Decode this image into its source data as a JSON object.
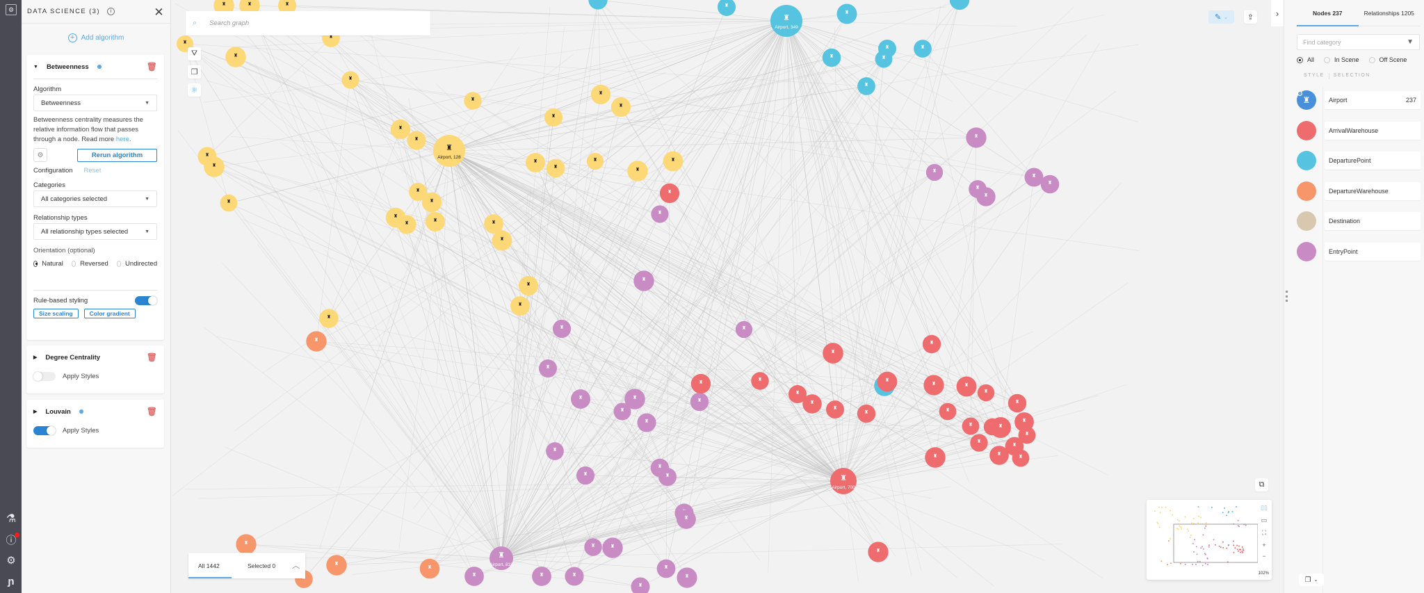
{
  "rail": {
    "top_icon": "panel-settings-icon",
    "bottom_icons": [
      "flask-icon",
      "help-icon",
      "gear-icon",
      "logo-icon"
    ],
    "help_has_notification": true
  },
  "data_science": {
    "title": "DATA SCIENCE (3)",
    "add_algorithm": "Add algorithm",
    "algorithms": [
      {
        "name": "Betweenness",
        "active_dot": true,
        "expanded": true,
        "algorithm_label": "Algorithm",
        "algorithm_value": "Betweenness",
        "description": "Betweenness centrality measures the relative information flow that passes through a node. Read more ",
        "description_link": "here",
        "description_end": ".",
        "rerun_label": "Rerun algorithm",
        "configuration_label": "Configuration",
        "reset_label": "Reset",
        "categories_label": "Categories",
        "categories_value": "All categories selected",
        "relationship_types_label": "Relationship types",
        "relationship_types_value": "All relationship types selected",
        "orientation_label": "Orientation (optional)",
        "orientation_options": [
          "Natural",
          "Reversed",
          "Undirected"
        ],
        "orientation_selected": "Natural",
        "rule_styling_label": "Rule-based styling",
        "rule_styling_on": true,
        "chips": [
          "Size scaling",
          "Color gradient"
        ]
      },
      {
        "name": "Degree Centrality",
        "active_dot": false,
        "expanded": false,
        "apply_styles_label": "Apply Styles",
        "apply_styles_on": false
      },
      {
        "name": "Louvain",
        "active_dot": true,
        "expanded": false,
        "apply_styles_label": "Apply Styles",
        "apply_styles_on": true
      }
    ]
  },
  "canvas": {
    "search_placeholder": "Search graph",
    "left_tools": [
      "filter-icon",
      "layers-icon",
      "data-science-icon"
    ],
    "count_bar": {
      "all": "All 1442",
      "selected": "Selected 0"
    },
    "minimap_zoom": "102%",
    "node_label_samples": [
      "Airport, 128",
      "Airport, 349",
      "Airport, 700",
      "Airport, 818"
    ]
  },
  "right_panel": {
    "tabs": [
      "Nodes 237",
      "Relationships 1205"
    ],
    "active_tab": "Nodes 237",
    "find_placeholder": "Find category",
    "scope_options": [
      "All",
      "In Scene",
      "Off Scene"
    ],
    "scope_selected": "All",
    "columns": [
      "STYLE",
      "SELECTION"
    ],
    "categories": [
      {
        "name": "Airport",
        "count": "237",
        "color": "#4a8fd9",
        "icon": "control-tower-icon"
      },
      {
        "name": "ArrivalWarehouse",
        "count": "",
        "color": "#ee6b6e",
        "icon": ""
      },
      {
        "name": "DeparturePoint",
        "count": "",
        "color": "#56c3e0",
        "icon": ""
      },
      {
        "name": "DepartureWarehouse",
        "count": "",
        "color": "#f7966a",
        "icon": ""
      },
      {
        "name": "Destination",
        "count": "",
        "color": "#d9c8b0",
        "icon": ""
      },
      {
        "name": "EntryPoint",
        "count": "",
        "color": "#c88bc4",
        "icon": ""
      }
    ]
  },
  "colors": {
    "accent": "#2a84d2",
    "link": "#5aa9e6",
    "yellow_node": "#fdd877",
    "red_node": "#ee6b6e",
    "cyan_node": "#56c3e0",
    "orange_node": "#f7966a",
    "purple_node": "#c88bc4"
  }
}
